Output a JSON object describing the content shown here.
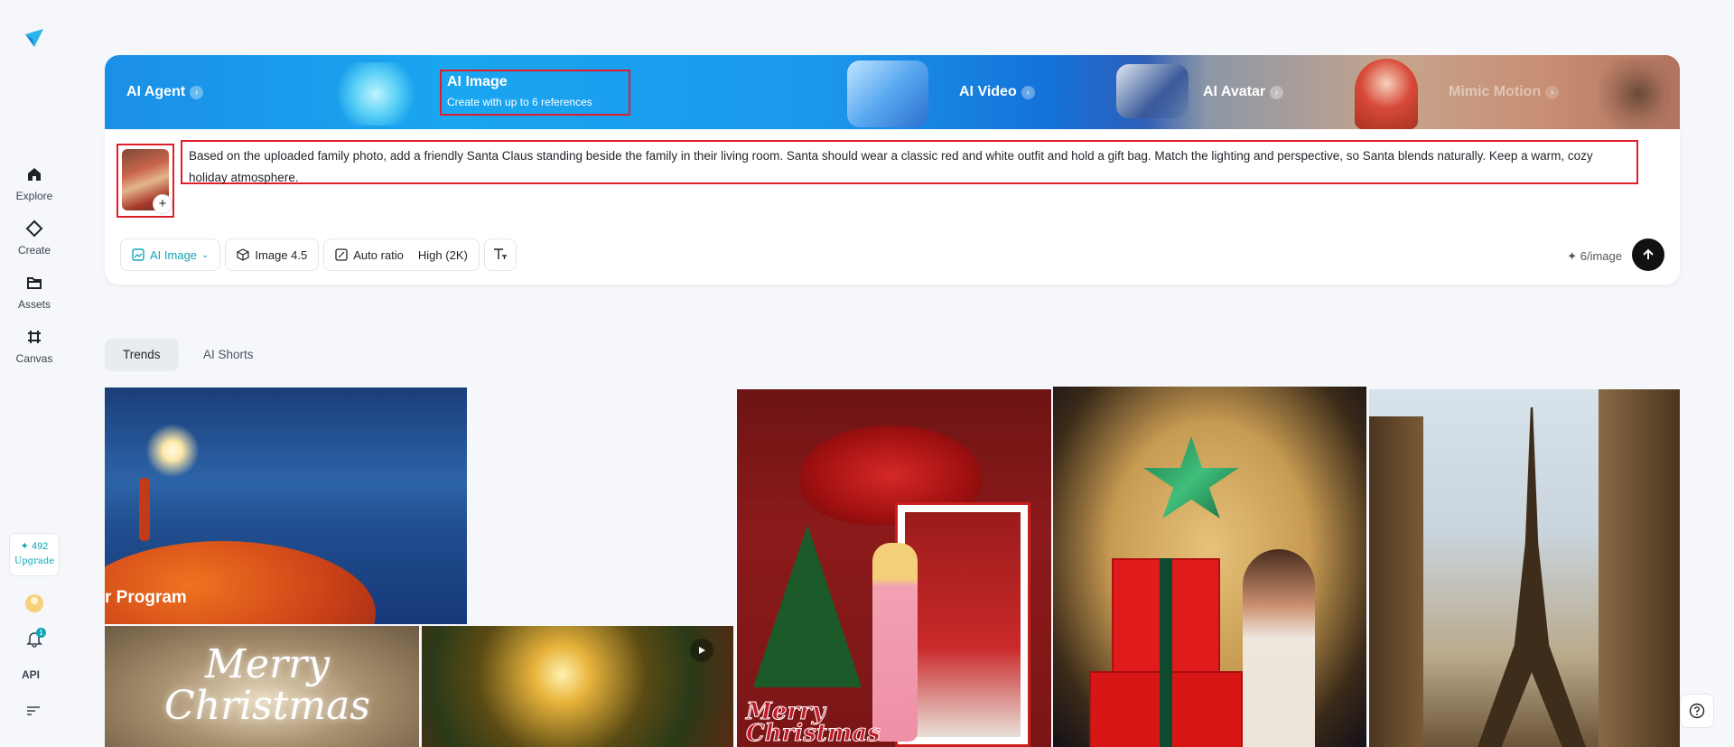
{
  "sidebar": {
    "logo": "app-logo-icon",
    "items": [
      {
        "label": "Explore",
        "icon": "home-icon"
      },
      {
        "label": "Create",
        "icon": "diamond-icon"
      },
      {
        "label": "Assets",
        "icon": "folder-icon"
      },
      {
        "label": "Canvas",
        "icon": "hash-crop-icon"
      }
    ],
    "credits": "✦ 492",
    "upgrade": "Upgrade",
    "notification_count": "1",
    "api": "API"
  },
  "banner": {
    "tabs": [
      {
        "label": "AI Agent"
      },
      {
        "label": "AI Image",
        "subtitle": "Create with up to 6 references",
        "selected": true
      },
      {
        "label": "AI Video"
      },
      {
        "label": "AI Avatar"
      },
      {
        "label": "Mimic Motion"
      }
    ]
  },
  "prompt": {
    "text": "Based on the uploaded family photo, add a friendly Santa Claus standing beside the family in their living room. Santa should wear a classic red and white outfit and hold a gift bag. Match the lighting and perspective, so Santa blends naturally. Keep a warm, cozy holiday atmosphere.",
    "add_reference": "+"
  },
  "toolbar": {
    "mode": "AI Image",
    "model": "Image 4.5",
    "ratio": "Auto ratio",
    "quality": "High (2K)",
    "cost": "✦ 6/image"
  },
  "feed": {
    "tabs": [
      {
        "label": "Trends",
        "active": true
      },
      {
        "label": "AI Shorts",
        "active": false
      }
    ],
    "tiles": [
      {
        "caption": "r Program"
      },
      {
        "caption": "Merry Christmas"
      },
      {
        "caption": ""
      },
      {
        "caption": "Merry Christmas"
      },
      {
        "caption": ""
      },
      {
        "caption": ""
      }
    ]
  },
  "colors": {
    "accent": "#0ea5b7",
    "highlight_border": "#e01e2a",
    "send_button": "#111111"
  }
}
